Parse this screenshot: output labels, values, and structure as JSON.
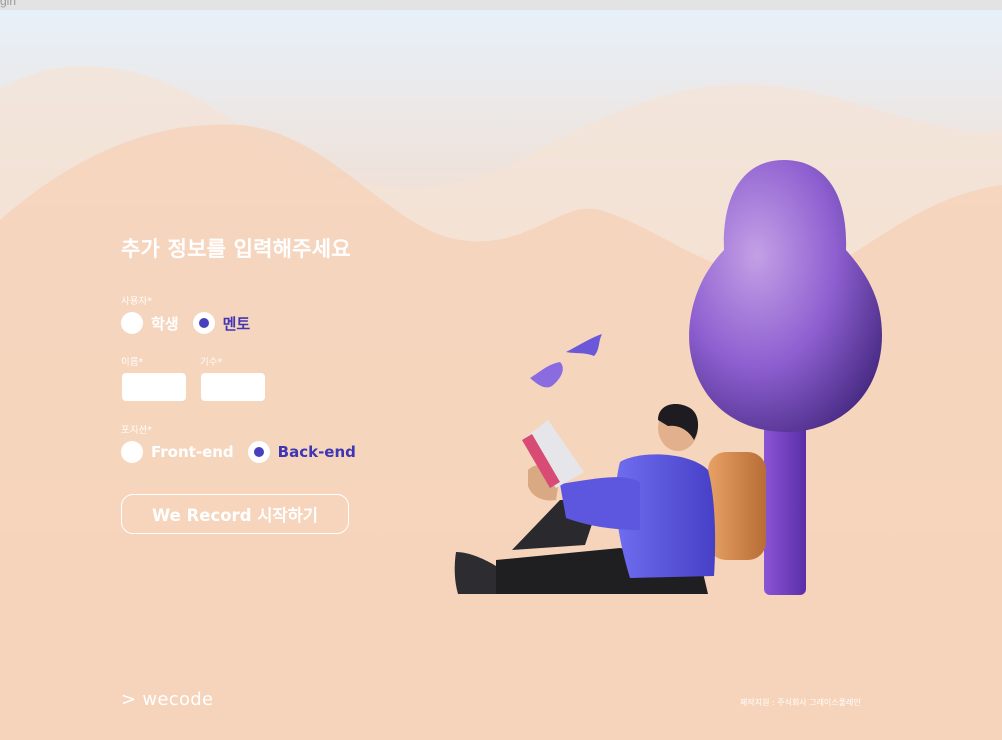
{
  "window": {
    "title_fragment": "gin"
  },
  "form": {
    "title": "추가 정보를 입력해주세요",
    "user_type": {
      "label": "사용자*",
      "options": [
        {
          "label": "학생",
          "checked": false
        },
        {
          "label": "멘토",
          "checked": true
        }
      ]
    },
    "name": {
      "label": "이름*",
      "value": ""
    },
    "generation": {
      "label": "기수*",
      "value": ""
    },
    "position": {
      "label": "포지션*",
      "options": [
        {
          "label": "Front-end",
          "checked": false
        },
        {
          "label": "Back-end",
          "checked": true
        }
      ]
    },
    "start_button": "We Record 시작하기"
  },
  "footer": {
    "logo": "> wecode",
    "copyright": "제작지원 : 주식회사 그레이스풀레인"
  },
  "colors": {
    "accent": "#4a3fbf",
    "accent_text": "#3f36b4",
    "background_top": "#e6f1fb",
    "background_bottom": "#fbc8a5"
  },
  "illustration": {
    "icon": "student-reading-under-tree-illustration"
  }
}
